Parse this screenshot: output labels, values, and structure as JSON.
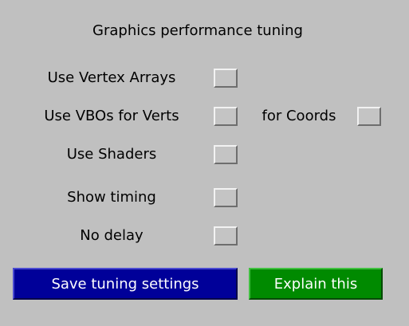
{
  "panel": {
    "title": "Graphics performance tuning"
  },
  "options": {
    "vertex_arrays": {
      "label": "Use Vertex Arrays",
      "checked": false
    },
    "vbos_verts": {
      "label": "Use VBOs for Verts",
      "checked": false
    },
    "vbos_coords": {
      "label": "for Coords",
      "checked": false
    },
    "shaders": {
      "label": "Use Shaders",
      "checked": false
    },
    "show_timing": {
      "label": "Show timing",
      "checked": false
    },
    "no_delay": {
      "label": "No delay",
      "checked": false
    }
  },
  "buttons": {
    "save_label": "Save tuning settings",
    "explain_label": "Explain this"
  },
  "colors": {
    "background": "#c0c0c0",
    "save_button": "#000099",
    "explain_button": "#008a00",
    "button_text": "#ffffff"
  }
}
